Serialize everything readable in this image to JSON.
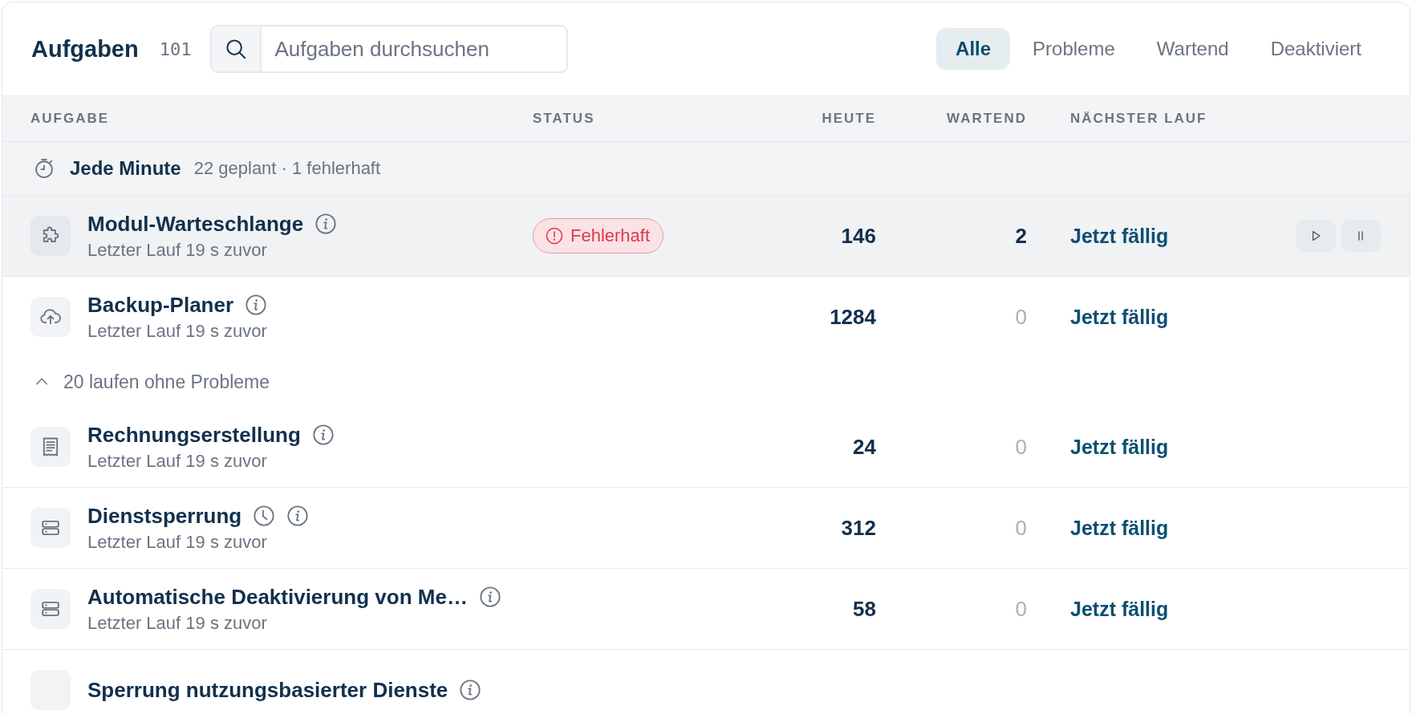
{
  "header": {
    "title": "Aufgaben",
    "count": "101",
    "search": {
      "placeholder": "Aufgaben durchsuchen"
    },
    "tabs": [
      {
        "label": "Alle",
        "selected": true
      },
      {
        "label": "Probleme",
        "selected": false
      },
      {
        "label": "Wartend",
        "selected": false
      },
      {
        "label": "Deaktiviert",
        "selected": false
      }
    ]
  },
  "table": {
    "columns": [
      "AUFGABE",
      "STATUS",
      "HEUTE",
      "WARTEND",
      "NÄCHSTER LAUF"
    ],
    "groups": [
      {
        "title": "Jede Minute",
        "summary": "22 geplant · 1 fehlerhaft",
        "items": [
          {
            "kind": "task",
            "name": "Modul-Warteschlange",
            "last_run": "Letzter Lauf 19 s zuvor",
            "scheduled": false,
            "status": {
              "label": "Fehlerhaft"
            },
            "today": "146",
            "waiting": {
              "value": "2",
              "muted": false
            },
            "next_run": "Jetzt fällig",
            "selected": true
          },
          {
            "kind": "task",
            "name": "Backup-Planer",
            "last_run": "Letzter Lauf 19 s zuvor",
            "scheduled": false,
            "today": "1284",
            "waiting": {
              "value": "0",
              "muted": true
            },
            "next_run": "Jetzt fällig",
            "selected": false
          },
          {
            "kind": "toggle",
            "label": "20 laufen ohne Probleme",
            "expanded": true
          },
          {
            "kind": "task",
            "name": "Rechnungserstellung",
            "last_run": "Letzter Lauf 19 s zuvor",
            "scheduled": false,
            "today": "24",
            "waiting": {
              "value": "0",
              "muted": true
            },
            "next_run": "Jetzt fällig",
            "selected": false
          },
          {
            "kind": "task",
            "name": "Dienstsperrung",
            "last_run": "Letzter Lauf 19 s zuvor",
            "scheduled": true,
            "today": "312",
            "waiting": {
              "value": "0",
              "muted": true
            },
            "next_run": "Jetzt fällig",
            "selected": false
          },
          {
            "kind": "task",
            "name": "Automatische Deaktivierung von Me…",
            "last_run": "Letzter Lauf 19 s zuvor",
            "scheduled": false,
            "today": "58",
            "waiting": {
              "value": "0",
              "muted": true
            },
            "next_run": "Jetzt fällig",
            "selected": false
          },
          {
            "kind": "task",
            "name": "Sperrung nutzungsbasierter Dienste",
            "scheduled": false,
            "selected": false
          }
        ]
      }
    ]
  }
}
